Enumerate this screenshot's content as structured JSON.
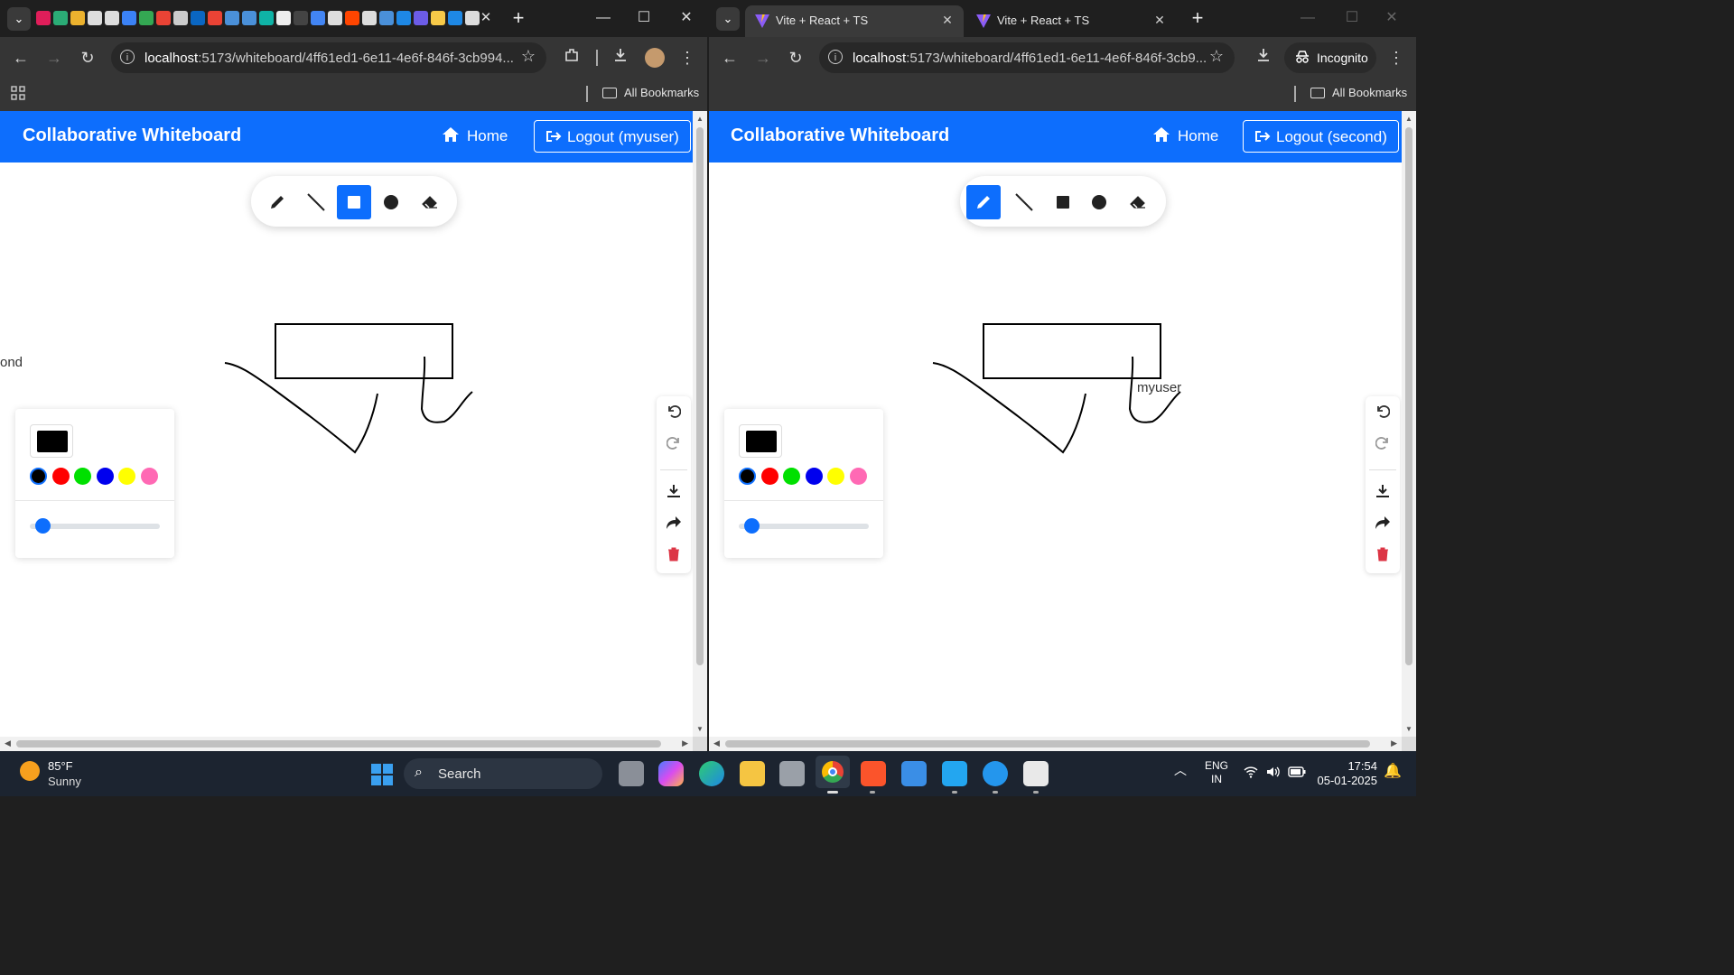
{
  "left_window": {
    "url_host": "localhost",
    "url_rest": ":5173/whiteboard/4ff61ed1-6e11-4e6f-846f-3cb994...",
    "bookmarks_label": "All Bookmarks",
    "app": {
      "brand": "Collaborative Whiteboard",
      "home_label": "Home",
      "logout_label": "Logout (myuser)",
      "active_tool": "rectangle",
      "remote_cursor_label": "ond"
    }
  },
  "right_window": {
    "tabs": [
      {
        "title": "Vite + React + TS",
        "active": true
      },
      {
        "title": "Vite + React + TS",
        "active": false
      }
    ],
    "url_host": "localhost",
    "url_rest": ":5173/whiteboard/4ff61ed1-6e11-4e6f-846f-3cb9...",
    "incognito_label": "Incognito",
    "bookmarks_label": "All Bookmarks",
    "app": {
      "brand": "Collaborative Whiteboard",
      "home_label": "Home",
      "logout_label": "Logout (second)",
      "active_tool": "pencil",
      "remote_cursor_label": "myuser"
    }
  },
  "tools": [
    "pencil-icon",
    "line-icon",
    "rectangle-icon",
    "circle-icon",
    "eraser-icon"
  ],
  "palette": {
    "selected": "#000000",
    "colors": [
      "#000000",
      "#ff0000",
      "#00e000",
      "#0000ee",
      "#ffff00",
      "#ff69b4"
    ],
    "brush_size_fraction": 0.1
  },
  "accent_color": "#0d6efd",
  "taskbar": {
    "temperature": "85°F",
    "condition": "Sunny",
    "search_placeholder": "Search",
    "language": "ENG",
    "region": "IN",
    "time": "17:54",
    "date": "05-01-2025"
  }
}
